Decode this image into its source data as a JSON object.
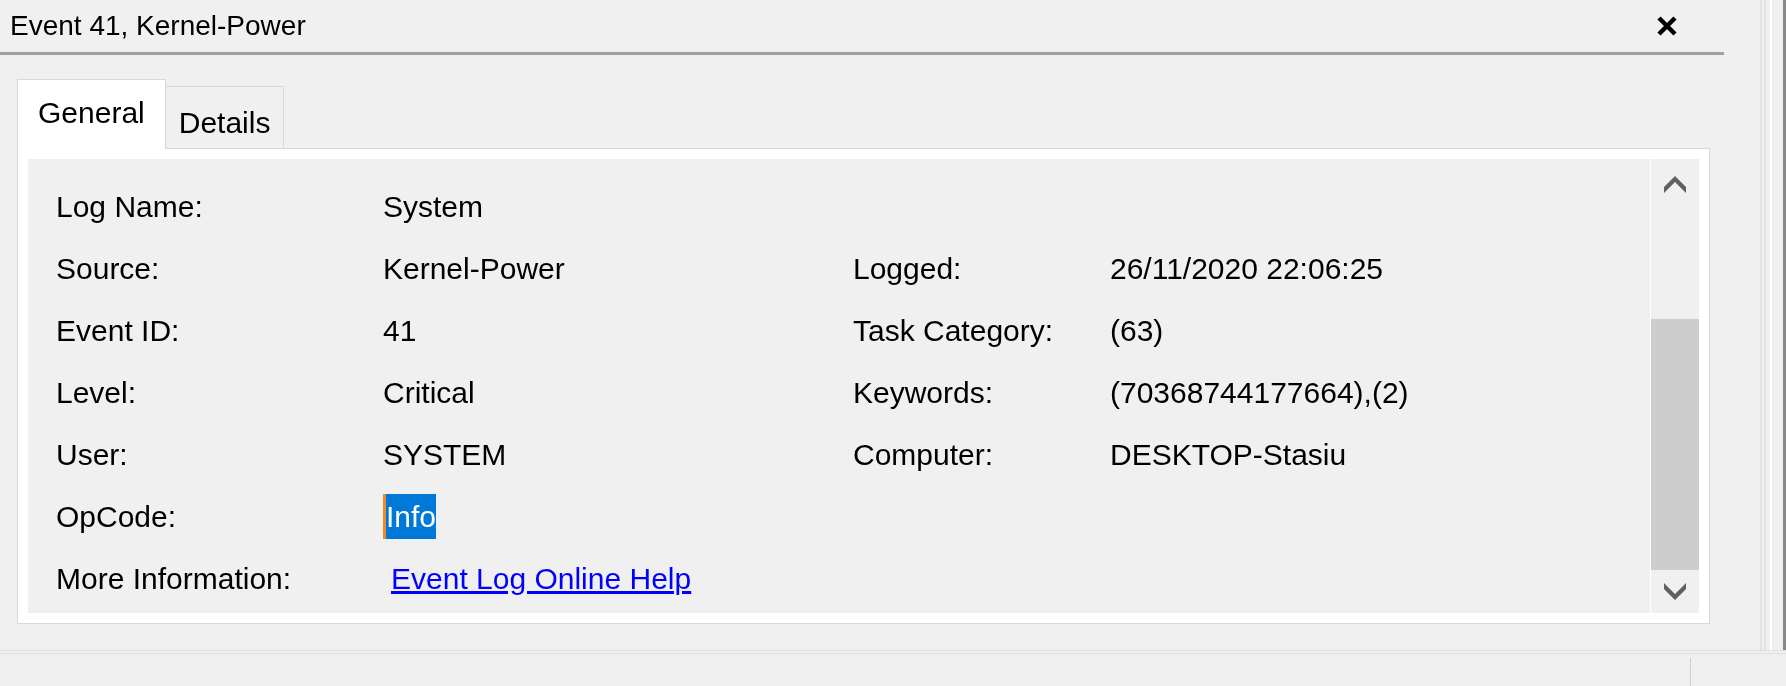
{
  "window": {
    "title": "Event 41, Kernel-Power"
  },
  "tabs": [
    {
      "label": "General",
      "selected": true
    },
    {
      "label": "Details",
      "selected": false
    }
  ],
  "rows": [
    {
      "kind": "text",
      "label": "Log Name:",
      "value": "System",
      "selected": false
    },
    {
      "kind": "text",
      "label": "Source:",
      "value": "Kernel-Power",
      "selected": false,
      "right_label": "Logged:",
      "right_value": "26/11/2020 22:06:25"
    },
    {
      "kind": "text",
      "label": "Event ID:",
      "value": "41",
      "selected": false,
      "right_label": "Task Category:",
      "right_value": "(63)"
    },
    {
      "kind": "text",
      "label": "Level:",
      "value": "Critical",
      "selected": false,
      "right_label": "Keywords:",
      "right_value": "(70368744177664),(2)"
    },
    {
      "kind": "text",
      "label": "User:",
      "value": "SYSTEM",
      "selected": false,
      "right_label": "Computer:",
      "right_value": "DESKTOP-Stasiu"
    },
    {
      "kind": "text",
      "label": "OpCode:",
      "value": "Info",
      "selected": true
    },
    {
      "kind": "link",
      "label": "More Information:",
      "value": "Event Log Online Help",
      "selected": false
    }
  ]
}
